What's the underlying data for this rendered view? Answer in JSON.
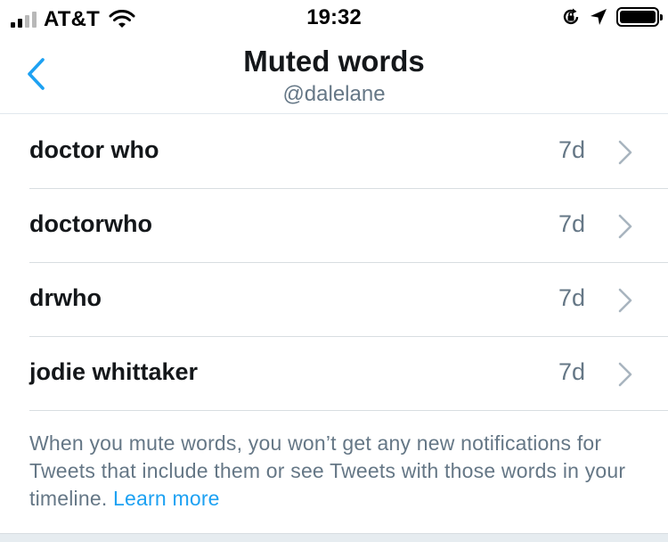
{
  "status_bar": {
    "carrier": "AT&T",
    "time": "19:32",
    "icons": [
      "signal-icon",
      "wifi-icon",
      "orientation-lock-icon",
      "location-icon",
      "battery-icon"
    ]
  },
  "nav": {
    "title": "Muted words",
    "subtitle": "@dalelane",
    "back_icon": "chevron-left-icon"
  },
  "muted_words": [
    {
      "word": "doctor who",
      "duration": "7d"
    },
    {
      "word": "doctorwho",
      "duration": "7d"
    },
    {
      "word": "drwho",
      "duration": "7d"
    },
    {
      "word": "jodie whittaker",
      "duration": "7d"
    }
  ],
  "info": {
    "text": "When you mute words, you won’t get any new notifications for Tweets that include them or see Tweets with those words in your timeline.",
    "link": "Learn more"
  },
  "colors": {
    "accent": "#1da1f2",
    "secondary_text": "#657786",
    "primary_text": "#14171a",
    "divider": "#d8dde1",
    "chevron": "#a8b4bf"
  }
}
